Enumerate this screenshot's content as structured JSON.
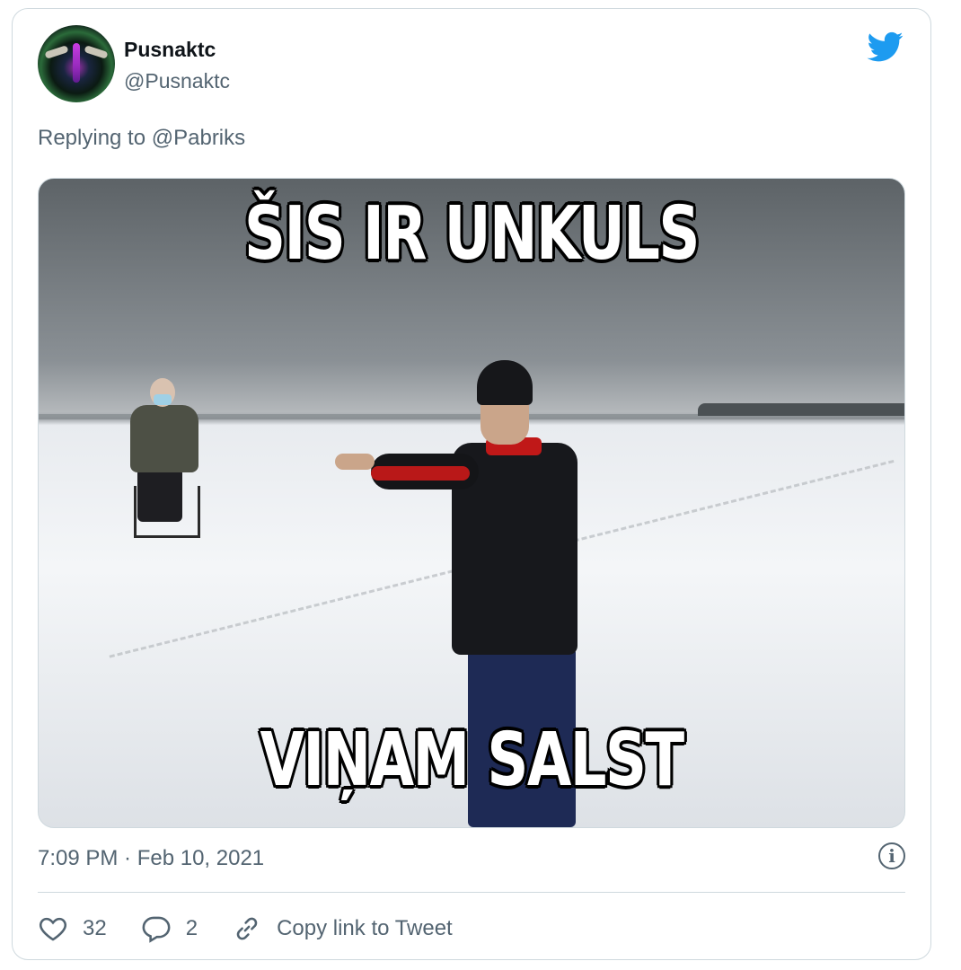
{
  "tweet": {
    "display_name": "Pusnaktc",
    "handle": "@Pusnaktc",
    "reply_prefix": "Replying to",
    "reply_to": "@Pabriks",
    "timestamp": "7:09 PM · Feb 10, 2021",
    "info_glyph": "i"
  },
  "media": {
    "top_caption": "ŠIS IR UNKULS",
    "bottom_caption": "VIŅAM SALST"
  },
  "actions": {
    "likes": "32",
    "replies": "2",
    "copy_link_label": "Copy link to Tweet"
  },
  "icons": {
    "brand": "twitter-bird-icon",
    "like": "heart-icon",
    "reply": "speech-bubble-icon",
    "link": "chain-link-icon",
    "info": "info-icon"
  },
  "colors": {
    "brand": "#1d9bf0",
    "secondary_text": "#536471",
    "border": "#cfd9de"
  }
}
